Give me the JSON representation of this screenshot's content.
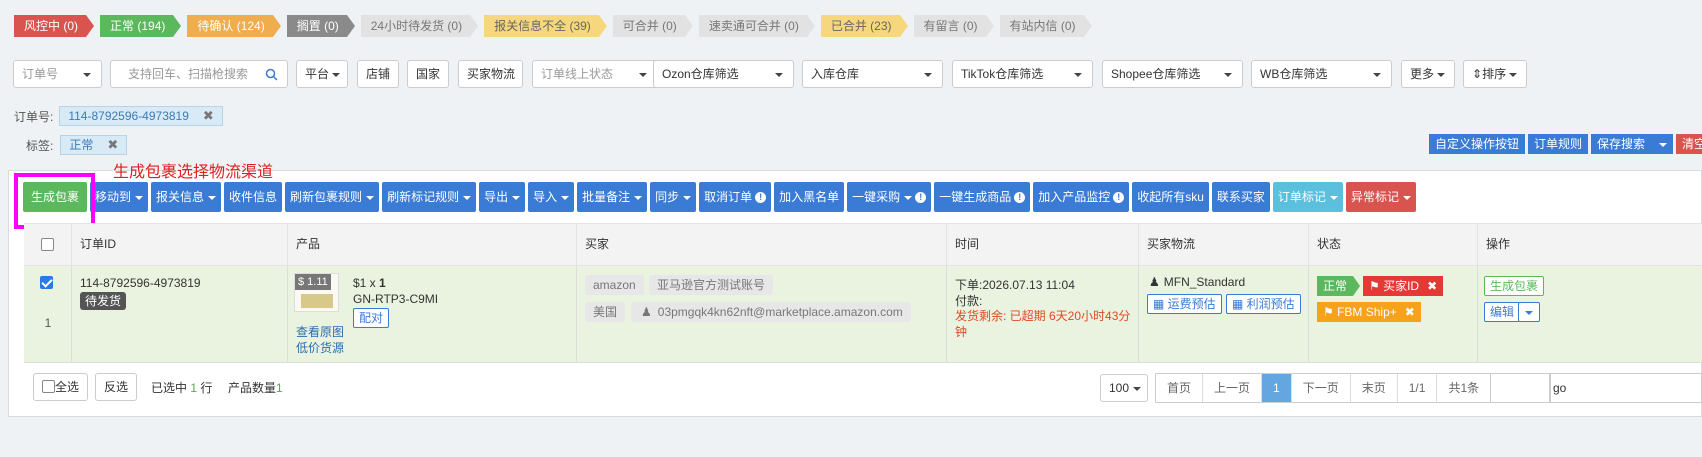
{
  "status_tabs": [
    {
      "label": "风控中 (0)",
      "style": "red"
    },
    {
      "label": "正常 (194)",
      "style": "green"
    },
    {
      "label": "待确认 (124)",
      "style": "orange"
    },
    {
      "label": "搁置 (0)",
      "style": "gray"
    },
    {
      "label": "24小时待发货 (0)",
      "style": "light"
    },
    {
      "label": "报关信息不全 (39)",
      "style": "yellow"
    },
    {
      "label": "可合并 (0)",
      "style": "light"
    },
    {
      "label": "速卖通可合并 (0)",
      "style": "light"
    },
    {
      "label": "已合并 (23)",
      "style": "yellow"
    },
    {
      "label": "有留言 (0)",
      "style": "light"
    },
    {
      "label": "有站内信 (0)",
      "style": "light"
    }
  ],
  "filters": {
    "order_no": "订单号",
    "search_placeholder": "支持回车、扫描枪搜索",
    "platform": "平台",
    "shop": "店铺",
    "country": "国家",
    "buyer_logistics": "买家物流",
    "online_status": "订单线上状态",
    "ozon": "Ozon仓库筛选",
    "inbound": "入库仓库",
    "tiktok": "TikTok仓库筛选",
    "shopee": "Shopee仓库筛选",
    "wb": "WB仓库筛选",
    "more": "更多",
    "sort": "排序"
  },
  "chips": {
    "order_label": "订单号:",
    "order_value": "114-8792596-4973819",
    "tag_label": "标签:",
    "tag_value": "正常"
  },
  "right_buttons": {
    "custom": "自定义操作按钮",
    "rules": "订单规则",
    "save_search": "保存搜索",
    "clear": "清空"
  },
  "annotation": "生成包裹选择物流渠道",
  "toolbar": {
    "generate": "生成包裹",
    "move_to": "移动到",
    "customs": "报关信息",
    "receiver": "收件信息",
    "refresh_pkg": "刷新包裹规则",
    "refresh_mark": "刷新标记规则",
    "export": "导出",
    "import": "导入",
    "batch_note": "批量备注",
    "sync": "同步",
    "cancel_order": "取消订单",
    "blacklist": "加入黑名单",
    "purchase": "一键采购",
    "gen_product": "一键生成商品",
    "monitor": "加入产品监控",
    "collect_sku": "收起所有sku",
    "contact_buyer": "联系买家",
    "order_mark": "订单标记",
    "abnormal_mark": "异常标记"
  },
  "columns": {
    "order_id": "订单ID",
    "product": "产品",
    "buyer": "买家",
    "time": "时间",
    "buyer_logistics": "买家物流",
    "status": "状态",
    "action": "操作"
  },
  "row": {
    "order_id": "114-8792596-4973819",
    "order_status": "待发货",
    "index": "1",
    "price_badge": "$ 1.11",
    "unit_price": "$1 x ",
    "qty": "1",
    "sku": "GN-RTP3-C9MI",
    "match_btn": "配对",
    "view_image": "查看原图",
    "cheap_source": "低价货源",
    "platform": "amazon",
    "account": "亚马逊官方测试账号",
    "country": "美国",
    "email": "03pmgqk4kn62nft@marketplace.amazon.com",
    "order_time": "下单:2026.07.13 11:04",
    "paid": "付款:",
    "ship_remaining": "发货剩余: 已超期 6天20小时43分钟",
    "shipping_method": "MFN_Standard",
    "freight_est": "运费预估",
    "profit_est": "利润预估",
    "status": "正常",
    "buyer_id_tag": "买家ID",
    "fbm_tag": "FBM Ship+",
    "gen_pkg_btn": "生成包裹",
    "edit_btn": "编辑"
  },
  "footer": {
    "select_all": "全选",
    "invert": "反选",
    "selected_prefix": "已选中 ",
    "selected_count": "1",
    "selected_suffix": " 行",
    "product_qty_label": "产品数量",
    "product_qty": "1",
    "page_size": "100",
    "first": "首页",
    "prev": "上一页",
    "current": "1",
    "next": "下一页",
    "last": "末页",
    "pages": "1/1",
    "total": "共1条",
    "go": "go"
  },
  "colors": {
    "primary": "#3a7bd5",
    "success": "#5cb85c",
    "danger": "#d9534f",
    "highlight": "#ff00ff"
  }
}
